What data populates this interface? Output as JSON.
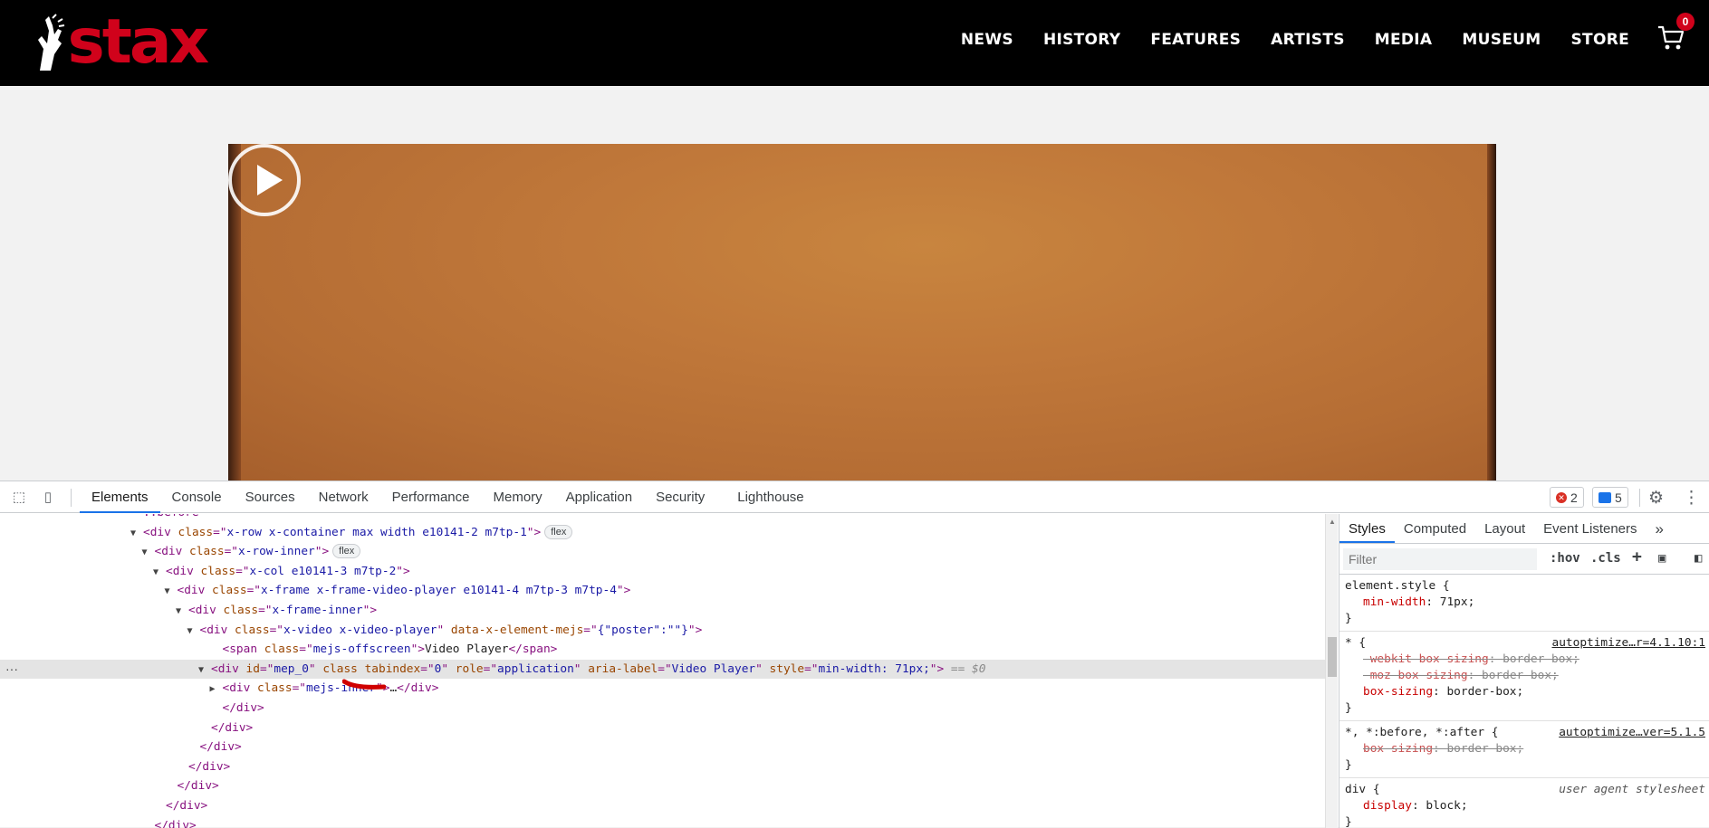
{
  "header": {
    "logo_text": "stax",
    "nav": [
      "NEWS",
      "HISTORY",
      "FEATURES",
      "ARTISTS",
      "MEDIA",
      "MUSEUM",
      "STORE"
    ],
    "cart_count": "0",
    "colors": {
      "background": "#000000",
      "brand": "#d0021b"
    }
  },
  "video": {
    "play_icon": "play-icon"
  },
  "devtools": {
    "tabs": [
      "Elements",
      "Console",
      "Sources",
      "Network",
      "Performance",
      "Memory",
      "Application",
      "Security",
      "Lighthouse"
    ],
    "error_count": "2",
    "message_count": "5",
    "elements": [
      {
        "indent": 12,
        "arrow": "",
        "html": [
          "ps::before"
        ]
      },
      {
        "indent": 12,
        "arrow": "▼",
        "html": [
          "<div ",
          "an class",
          "=\"",
          "av x-row x-container max width e10141-2 m7tp-1",
          "\">"
        ],
        "pill": "flex"
      },
      {
        "indent": 13,
        "arrow": "▼",
        "html": [
          "<div ",
          "an class",
          "=\"",
          "av x-row-inner",
          "\">"
        ],
        "pill": "flex"
      },
      {
        "indent": 14,
        "arrow": "▼",
        "html": [
          "<div ",
          "an class",
          "=\"",
          "av x-col e10141-3 m7tp-2",
          "\">"
        ]
      },
      {
        "indent": 15,
        "arrow": "▼",
        "html": [
          "<div ",
          "an class",
          "=\"",
          "av x-frame x-frame-video-player e10141-4 m7tp-3 m7tp-4",
          "\">"
        ]
      },
      {
        "indent": 16,
        "arrow": "▼",
        "html": [
          "<div ",
          "an class",
          "=\"",
          "av x-frame-inner",
          "\">"
        ]
      },
      {
        "indent": 17,
        "arrow": "▼",
        "html": [
          "<div ",
          "an class",
          "=\"",
          "av x-video x-video-player",
          "\" ",
          "an data-x-element-mejs",
          "=\"",
          "av {\"poster\":\"\"}",
          "\">"
        ]
      },
      {
        "indent": 19,
        "arrow": "",
        "html": [
          "<span ",
          "an class",
          "=\"",
          "av mejs-offscreen",
          "\">",
          "txVideo Player",
          "</span>"
        ]
      },
      {
        "indent": 18,
        "arrow": "▼",
        "selected": true,
        "html": [
          "<div ",
          "an id",
          "=\"",
          "av mep_0",
          "\" ",
          "an class",
          " ",
          "an tabindex",
          "=\"",
          "av 0",
          "\" ",
          "an role",
          "=\"",
          "av application",
          "\" ",
          "an aria-label",
          "=\"",
          "av Video Player",
          "\" ",
          "an style",
          "=\"",
          "av min-width: 71px;",
          "\">"
        ],
        "eq": " == $0"
      },
      {
        "indent": 19,
        "arrow": "▶",
        "html": [
          "<div ",
          "an class",
          "=\"",
          "av mejs-inner",
          "\">",
          "tx…",
          "</div>"
        ]
      },
      {
        "indent": 19,
        "arrow": "",
        "html": [
          "</div>"
        ]
      },
      {
        "indent": 18,
        "arrow": "",
        "html": [
          "</div>"
        ]
      },
      {
        "indent": 17,
        "arrow": "",
        "html": [
          "</div>"
        ]
      },
      {
        "indent": 16,
        "arrow": "",
        "html": [
          "</div>"
        ]
      },
      {
        "indent": 15,
        "arrow": "",
        "html": [
          "</div>"
        ]
      },
      {
        "indent": 14,
        "arrow": "",
        "html": [
          "</div>"
        ]
      },
      {
        "indent": 13,
        "arrow": "",
        "html": [
          "</div>"
        ]
      }
    ],
    "styles": {
      "tabs": [
        "Styles",
        "Computed",
        "Layout",
        "Event Listeners"
      ],
      "filter_placeholder": "Filter",
      "hov": ":hov",
      "cls": ".cls",
      "rules": [
        {
          "selector": "element.style {",
          "source": "",
          "decls": [
            {
              "prop": "min-width",
              "value": "71px;",
              "struck": false
            }
          ]
        },
        {
          "selector": "* {",
          "source": "autoptimize…r=4.1.10:1",
          "decls": [
            {
              "prop": "-webkit-box-sizing",
              "value": "border-box;",
              "struck": true
            },
            {
              "prop": "-moz-box-sizing",
              "value": "border-box;",
              "struck": true
            },
            {
              "prop": "box-sizing",
              "value": "border-box;",
              "struck": false
            }
          ]
        },
        {
          "selector": "*, *:before, *:after {",
          "source": "autoptimize…ver=5.1.5",
          "decls": [
            {
              "prop": "box-sizing",
              "value": "border-box;",
              "struck": true
            }
          ]
        },
        {
          "selector": "div {",
          "source": "user agent stylesheet",
          "ua": true,
          "decls": [
            {
              "prop": "display",
              "value": "block;",
              "struck": false
            }
          ]
        }
      ]
    }
  }
}
